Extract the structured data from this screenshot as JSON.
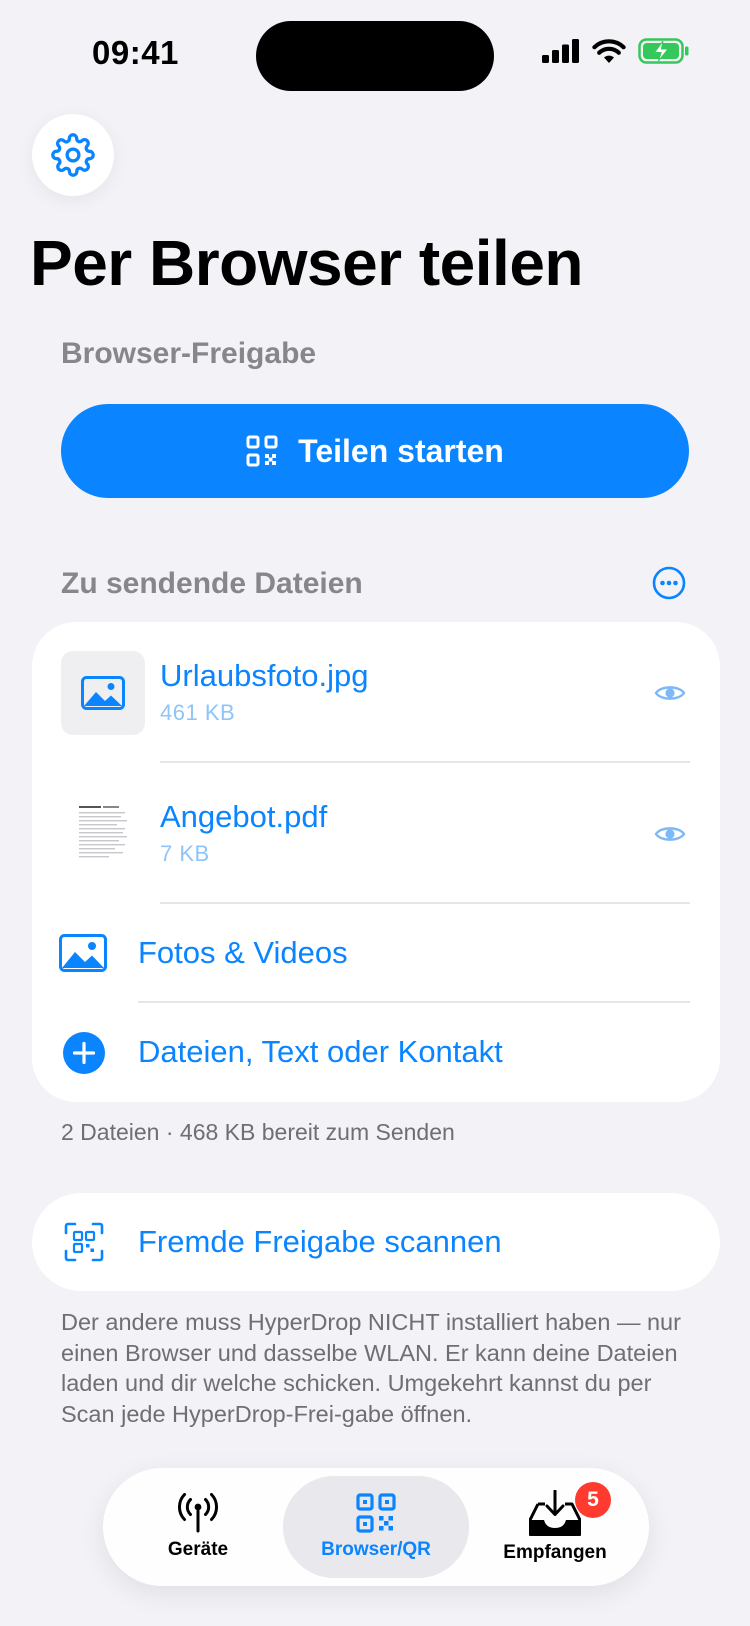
{
  "status_bar": {
    "time": "09:41"
  },
  "header": {
    "title": "Per Browser teilen"
  },
  "browser_share": {
    "section_label": "Browser-Freigabe",
    "start_button_label": "Teilen starten"
  },
  "files_section": {
    "section_label": "Zu sendende Dateien",
    "files": [
      {
        "name": "Urlaubsfoto.jpg",
        "size": "461 KB",
        "thumb_icon": "photo-icon"
      },
      {
        "name": "Angebot.pdf",
        "size": "7 KB",
        "thumb_icon": "document-thumbnail"
      }
    ],
    "add_photos_label": "Fotos & Videos",
    "add_files_label": "Dateien, Text oder Kontakt",
    "summary": "2 Dateien · 468 KB bereit zum Senden"
  },
  "scan": {
    "label": "Fremde Freigabe scannen",
    "note": "Der andere muss HyperDrop NICHT installiert haben — nur einen Browser und dasselbe WLAN. Er kann deine Dateien laden und dir welche schicken. Umgekehrt kannst du per Scan jede HyperDrop-Frei-gabe öffnen."
  },
  "tabbar": {
    "tabs": [
      {
        "label": "Geräte",
        "icon": "antenna-icon",
        "active": false
      },
      {
        "label": "Browser/QR",
        "icon": "qr-code-icon",
        "active": true
      },
      {
        "label": "Empfangen",
        "icon": "inbox-download-icon",
        "active": false,
        "badge": "5"
      }
    ]
  },
  "colors": {
    "accent": "#0A84FF",
    "background": "#F2F2F7",
    "badge": "#FF3B30",
    "battery": "#34C759"
  }
}
